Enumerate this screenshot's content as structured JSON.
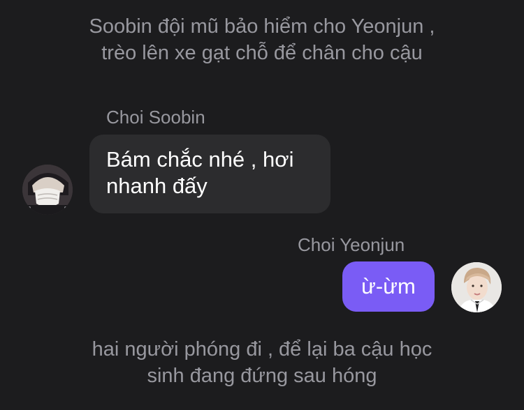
{
  "narration_top": {
    "line1": "Soobin đội mũ bảo hiểm cho Yeonjun ,",
    "line2": "trèo lên xe gạt chỗ để chân cho cậu"
  },
  "messages": [
    {
      "sender": "Choi Soobin",
      "lines": [
        "Bám chắc nhé , hơi",
        "nhanh đấy"
      ],
      "bubble_color": "#2c2c2e"
    },
    {
      "sender": "Choi Yeonjun",
      "text": "ừ-ừm",
      "bubble_color": "#7a5cf5"
    }
  ],
  "narration_bottom": {
    "line1": "hai người phóng đi , để lại ba cậu học",
    "line2": "sinh đang đứng sau hóng"
  },
  "colors": {
    "background": "#1c1c1e",
    "secondary_text": "#98989f",
    "accent": "#7a5cf5"
  }
}
